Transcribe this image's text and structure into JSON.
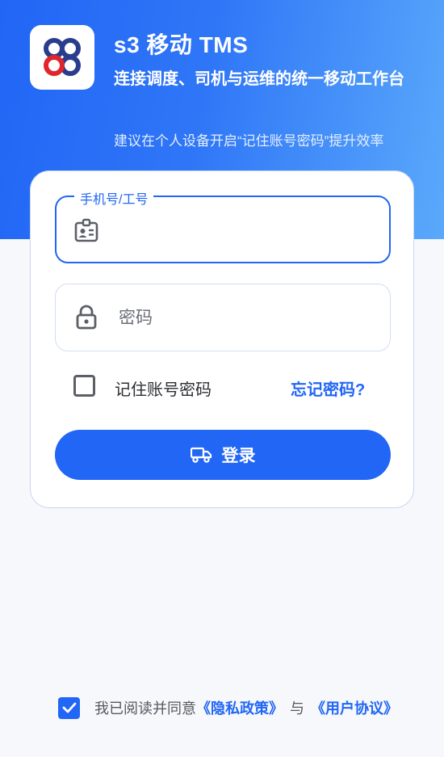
{
  "header": {
    "app_title": "s3 移动 TMS",
    "subtitle": "连接调度、司机与运维的统一移动工作台",
    "hint": "建议在个人设备开启“记住账号密码”提升效率"
  },
  "form": {
    "phone_label": "手机号/工号",
    "phone_value": "",
    "password_placeholder": "密码",
    "password_value": "",
    "remember_label": "记住账号密码",
    "remember_checked": false,
    "forgot_link": "忘记密码?",
    "login_button": "登录"
  },
  "agreement": {
    "checked": true,
    "text": "我已阅读并同意",
    "privacy_link": "《隐私政策》",
    "separator": "与",
    "terms_link": "《用户协议》"
  },
  "colors": {
    "primary": "#2166f5",
    "logo_navy": "#2a3c8c",
    "logo_red": "#e0262d"
  },
  "icons": {
    "phone_field": "id-badge-icon",
    "password_field": "lock-icon",
    "login": "truck-icon",
    "agree": "checkmark-icon"
  }
}
